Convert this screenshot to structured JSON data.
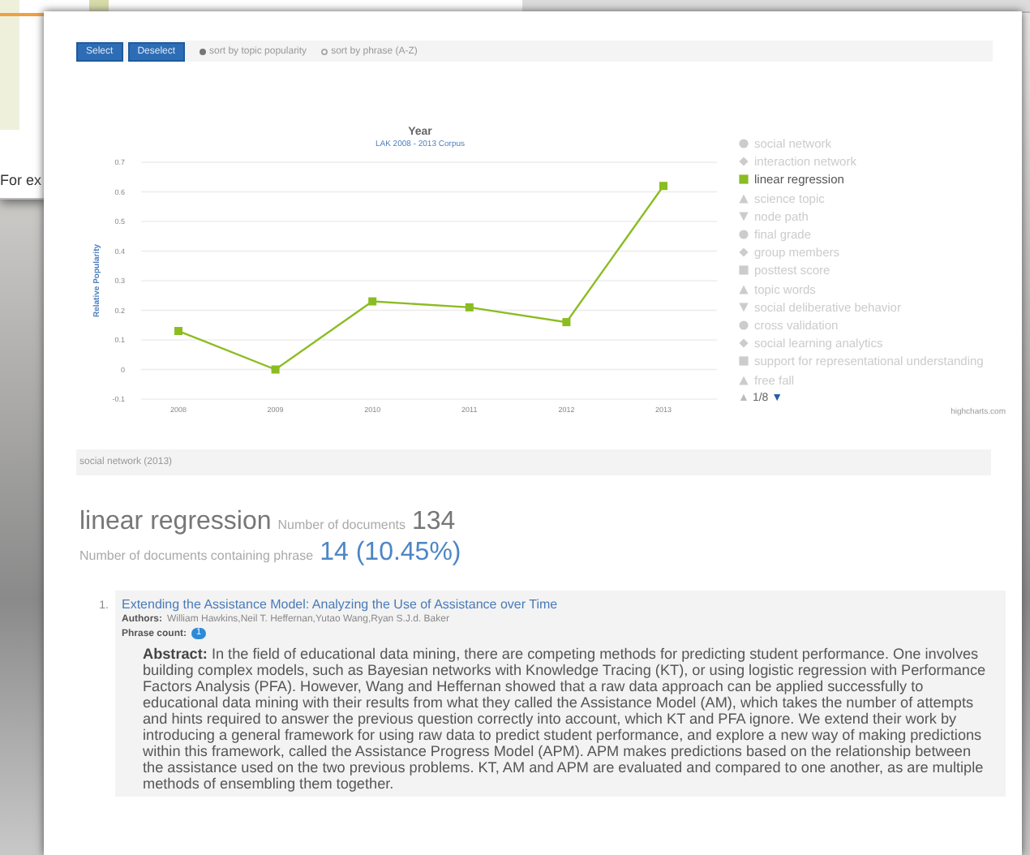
{
  "background": {
    "text": "For ex"
  },
  "toolbar": {
    "buttons": [
      "Select",
      "Deselect"
    ],
    "sort_options": [
      {
        "label": "sort by topic popularity",
        "selected": true
      },
      {
        "label": "sort by phrase (A-Z)",
        "selected": false
      }
    ]
  },
  "chart": {
    "subtitle": "LAK 2008 - 2013 Corpus",
    "chart_data": {
      "type": "line",
      "title": "Year",
      "ylabel": "Relative Popularity",
      "categories": [
        "2008",
        "2009",
        "2010",
        "2011",
        "2012",
        "2013"
      ],
      "ylim": [
        -0.1,
        0.7
      ],
      "yticks": [
        -0.1,
        0,
        0.1,
        0.2,
        0.3,
        0.4,
        0.5,
        0.6,
        0.7
      ],
      "series": [
        {
          "color": "#8bbc21",
          "marker": "square",
          "values": [
            0.13,
            0,
            0.23,
            0.21,
            0.16,
            0.62
          ]
        }
      ],
      "grid": true
    },
    "legend": [
      {
        "label": "social network",
        "kind": "circle",
        "selected": false
      },
      {
        "label": "interaction network",
        "kind": "diamond",
        "selected": false
      },
      {
        "label": "linear regression",
        "kind": "square",
        "selected": true
      },
      {
        "label": "science topic",
        "kind": "triangle",
        "selected": false
      },
      {
        "label": "node path",
        "kind": "triangle-down",
        "selected": false
      },
      {
        "label": "final grade",
        "kind": "circle",
        "selected": false
      },
      {
        "label": "group members",
        "kind": "diamond",
        "selected": false
      },
      {
        "label": "posttest score",
        "kind": "square",
        "selected": false
      },
      {
        "label": "topic words",
        "kind": "triangle",
        "selected": false
      },
      {
        "label": "social deliberative behavior",
        "kind": "triangle-down",
        "selected": false
      },
      {
        "label": "cross validation",
        "kind": "circle",
        "selected": false
      },
      {
        "label": "social learning analytics",
        "kind": "diamond",
        "selected": false
      },
      {
        "label": "support for representational understanding",
        "kind": "square",
        "selected": false
      },
      {
        "label": "free fall",
        "kind": "triangle",
        "selected": false
      }
    ],
    "pager": {
      "up": "▲",
      "text": "1/8",
      "down": "▼"
    },
    "credit": "highcharts.com"
  },
  "breadcrumb": "social network (2013)",
  "summary": {
    "phrase": "linear regression",
    "documents_label": "Number of documents",
    "documents": "134",
    "containing_label": "Number of documents containing phrase",
    "containing": "14 (10.45%)"
  },
  "documents": [
    {
      "number": "1.",
      "title": "Extending the Assistance Model: Analyzing the Use of Assistance over Time",
      "authors_label": "Authors:",
      "authors": "William Hawkins,Neil T. Heffernan,Yutao Wang,Ryan S.J.d. Baker",
      "count_label": "Phrase count:",
      "count": "1",
      "abstract": "**Abstract:** In the field of educational data mining, there are competing methods for predicting student performance. One involves building complex models, such as Bayesian networks with Knowledge Tracing (KT), or using logistic regression with Performance Factors Analysis (PFA). However, Wang and Heffernan showed that a raw data approach can be applied successfully to educational data mining with their results from what they called the Assistance Model (AM), which takes the number of attempts and hints required to answer the previous question correctly into account, which KT and PFA ignore. We extend their work by introducing a general framework for using raw data to predict student performance, and explore a new way of making predictions within this framework, called the Assistance Progress Model (APM). APM makes predictions based on the relationship between the assistance used on the two previous problems. KT, AM and APM are evaluated and compared to one another, as are multiple methods of ensembling them together."
    }
  ]
}
